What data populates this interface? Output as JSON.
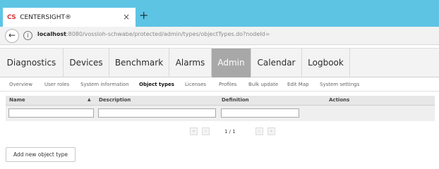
{
  "browser": {
    "tab": {
      "favicon": "CS",
      "title": "CENTERSIGHT®",
      "close": "×"
    },
    "new_tab": "+",
    "back": "←",
    "info": "i",
    "url_host": "localhost",
    "url_path": ":8080/vossloh-schwabe/protected/admin/types/objectTypes.do?nodeId="
  },
  "topnav": {
    "items": [
      {
        "label": "Diagnostics"
      },
      {
        "label": "Devices"
      },
      {
        "label": "Benchmark"
      },
      {
        "label": "Alarms"
      },
      {
        "label": "Admin",
        "active": true
      },
      {
        "label": "Calendar"
      },
      {
        "label": "Logbook"
      }
    ]
  },
  "subnav": {
    "items": [
      {
        "label": "Overview"
      },
      {
        "label": "User roles"
      },
      {
        "label": "System information"
      },
      {
        "label": "Object types",
        "active": true
      },
      {
        "label": "Licenses"
      },
      {
        "label": "Profiles"
      },
      {
        "label": "Bulk update"
      },
      {
        "label": "Edit Map"
      },
      {
        "label": "System settings"
      }
    ]
  },
  "table": {
    "columns": [
      {
        "label": "Name"
      },
      {
        "label": "Description"
      },
      {
        "label": "Definition"
      },
      {
        "label": "Actions"
      }
    ],
    "sort_icon": "▲",
    "filters": {
      "name": "",
      "description": "",
      "definition": ""
    }
  },
  "pager": {
    "first": "«",
    "prev": "‹",
    "info": "1 / 1",
    "next": "›",
    "last": "»"
  },
  "actions": {
    "add_label": "Add new object type"
  },
  "colors": {
    "tabstrip": "#5ec4e4",
    "active_nav": "#a8a8a8",
    "favicon": "#d63a3a"
  }
}
